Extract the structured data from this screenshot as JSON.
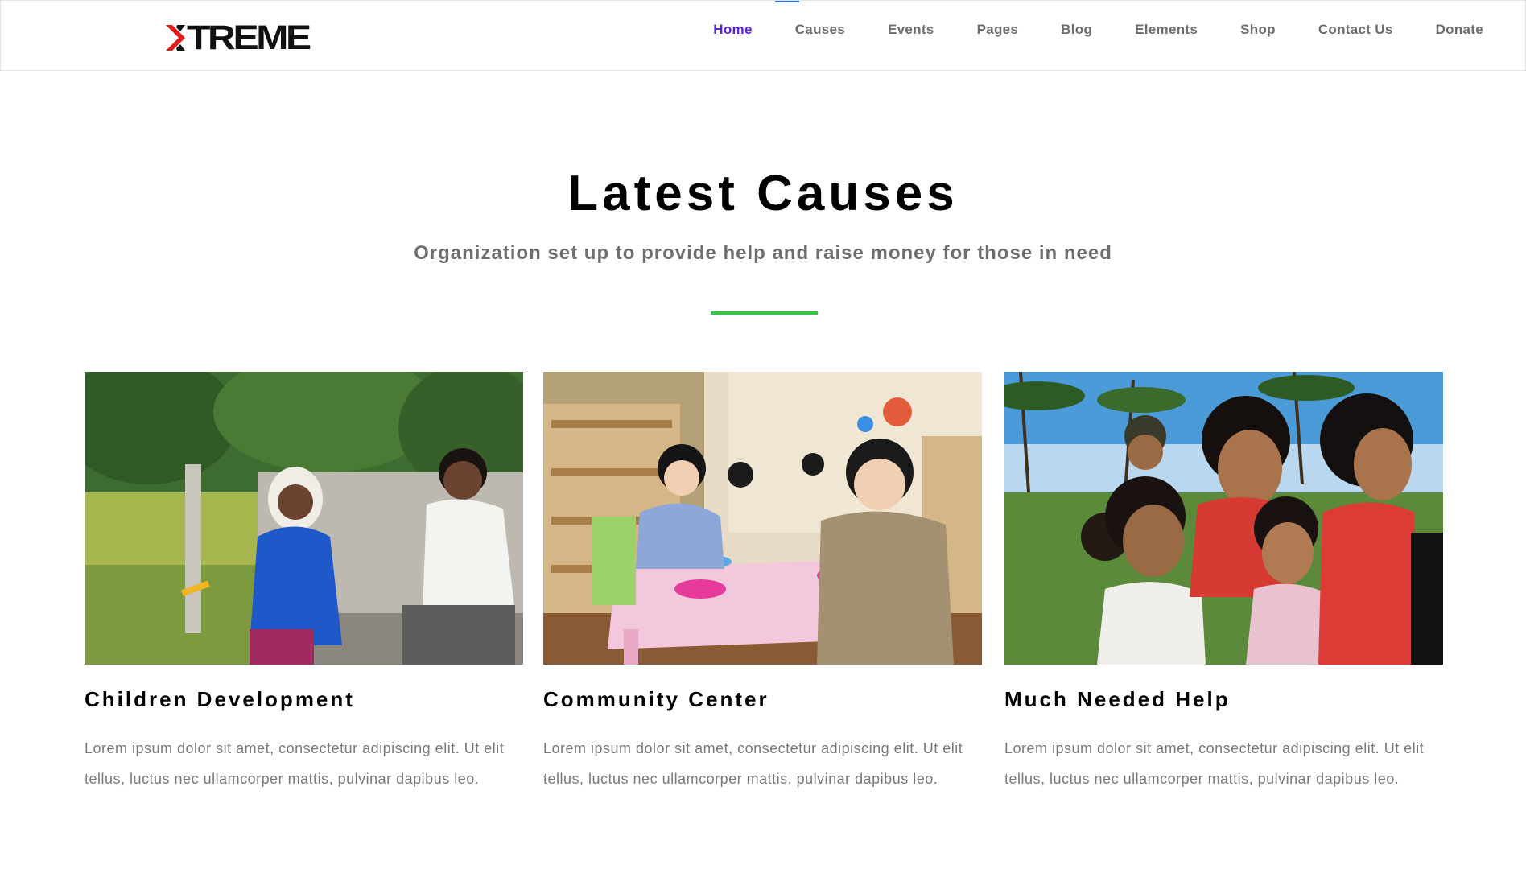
{
  "header": {
    "logo_text": "TREME",
    "nav": [
      {
        "label": "Home",
        "active": true
      },
      {
        "label": "Causes"
      },
      {
        "label": "Events"
      },
      {
        "label": "Pages"
      },
      {
        "label": "Blog"
      },
      {
        "label": "Elements"
      },
      {
        "label": "Shop"
      },
      {
        "label": "Contact Us"
      },
      {
        "label": "Donate"
      }
    ]
  },
  "section": {
    "title": "Latest Causes",
    "subtitle": "Organization set up to provide help and raise money for those in need"
  },
  "cards": [
    {
      "title": "Children Development",
      "text": "Lorem ipsum dolor sit amet, consectetur adipiscing elit. Ut elit tellus, luctus nec ullamcorper mattis, pulvinar dapibus leo."
    },
    {
      "title": "Community Center",
      "text": "Lorem ipsum dolor sit amet, consectetur adipiscing elit. Ut elit tellus, luctus nec ullamcorper mattis, pulvinar dapibus leo."
    },
    {
      "title": "Much Needed Help",
      "text": "Lorem ipsum dolor sit amet, consectetur adipiscing elit. Ut elit tellus, luctus nec ullamcorper mattis, pulvinar dapibus leo."
    }
  ],
  "colors": {
    "accent_nav": "#5b21d6",
    "divider": "#2ecc40",
    "logo_x": "#e21b1b"
  }
}
